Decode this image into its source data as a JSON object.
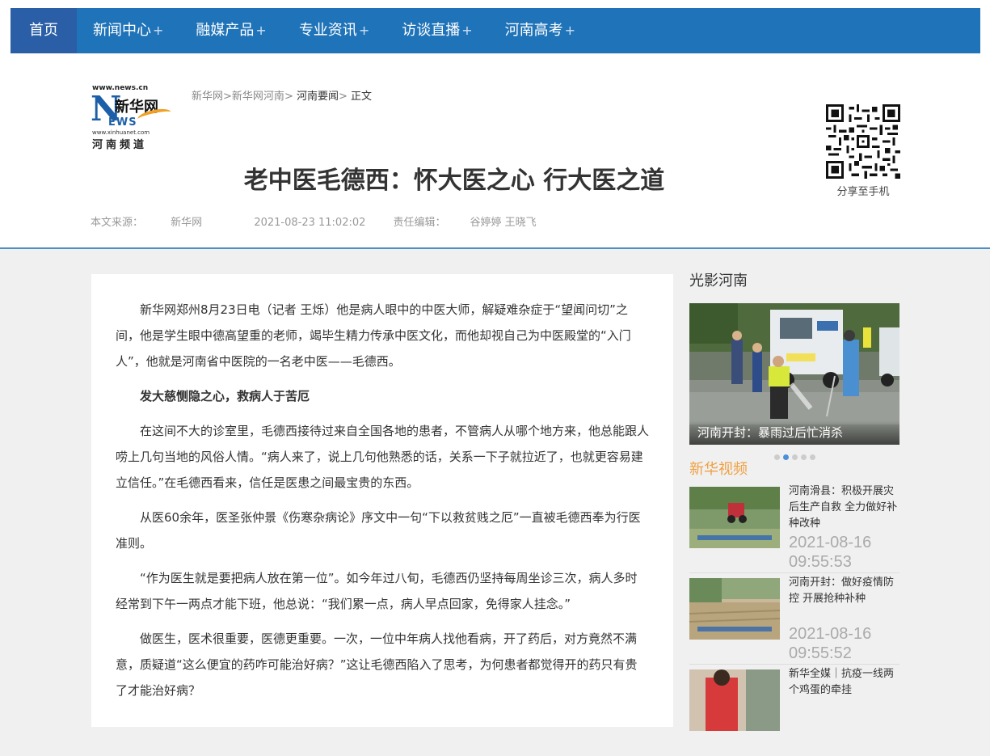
{
  "nav": {
    "home": "首页",
    "items": [
      {
        "label": "新闻中心",
        "plus": "+"
      },
      {
        "label": "融媒产品",
        "plus": "+"
      },
      {
        "label": "专业资讯",
        "plus": "+"
      },
      {
        "label": "访谈直播",
        "plus": "+"
      },
      {
        "label": "河南高考",
        "plus": "+"
      }
    ]
  },
  "logo": {
    "domain": "www.news.cn",
    "brand": "新华网",
    "ews": "EWS",
    "url": "www.xinhuanet.com",
    "channel": "河南频道"
  },
  "breadcrumb": {
    "items": [
      "新华网",
      "新华网河南",
      "河南要闻"
    ],
    "current": "正文",
    "sep": ">"
  },
  "article": {
    "title": "老中医毛德西：怀大医之心 行大医之道",
    "source_label": "本文来源：",
    "source": "新华网",
    "datetime": "2021-08-23 11:02:02",
    "editor_label": "责任编辑：",
    "editor": "谷婷婷 王晓飞",
    "paragraphs": [
      "新华网郑州8月23日电（记者 王烁）他是病人眼中的中医大师，解疑难杂症于“望闻问切”之间，他是学生眼中德高望重的老师，竭毕生精力传承中医文化，而他却视自己为中医殿堂的“入门人”，他就是河南省中医院的一名老中医——毛德西。",
      "发大慈恻隐之心，救病人于苦厄",
      "在这间不大的诊室里，毛德西接待过来自全国各地的患者，不管病人从哪个地方来，他总能跟人唠上几句当地的风俗人情。“病人来了，说上几句他熟悉的话，关系一下子就拉近了，也就更容易建立信任。”在毛德西看来，信任是医患之间最宝贵的东西。",
      "从医60余年，医圣张仲景《伤寒杂病论》序文中一句“下以救贫贱之厄”一直被毛德西奉为行医准则。",
      "“作为医生就是要把病人放在第一位”。如今年过八旬，毛德西仍坚持每周坐诊三次，病人多时经常到下午一两点才能下班，他总说：“我们累一点，病人早点回家，免得家人挂念。”",
      "做医生，医术很重要，医德更重要。一次，一位中年病人找他看病，开了药后，对方竟然不满意，质疑道“这么便宜的药咋可能治好病？”这让毛德西陷入了思考，为何患者都觉得开的药只有贵了才能治好病？"
    ]
  },
  "qr": {
    "label": "分享至手机"
  },
  "sidebar": {
    "photo_title": "光影河南",
    "photo_caption": "河南开封：暴雨过后忙消杀",
    "video_title": "新华视频",
    "videos": [
      {
        "title": "河南滑县：积极开展灾后生产自救 全力做好补种改种",
        "time": "2021-08-16 09:55:53"
      },
      {
        "title": "河南开封：做好疫情防控 开展抢种补种",
        "time": "2021-08-16 09:55:52"
      },
      {
        "title": "新华全媒｜抗疫一线两个鸡蛋的牵挂",
        "time": ""
      }
    ]
  },
  "colors": {
    "nav": "#1f73b8",
    "nav_home": "#2a5ea6",
    "video_title": "#f0a040"
  }
}
